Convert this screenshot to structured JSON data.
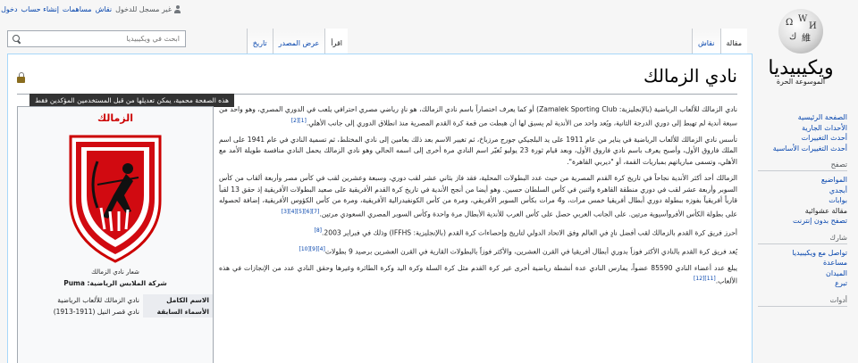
{
  "personal": {
    "not_logged_in": "غير مسجل للدخول",
    "talk": "نقاش",
    "contributions": "مساهمات",
    "create_account": "إنشاء حساب",
    "login": "دخول"
  },
  "logo": {
    "wordmark": "ويكيبيديا",
    "tagline": "الموسوعة الحرة"
  },
  "sidebar": {
    "main_links": [
      "الصفحة الرئيسية",
      "الأحداث الجارية",
      "أحدث التغييرات",
      "أحدث التغييرات الأساسية"
    ],
    "browse_heading": "تصفح",
    "browse_links": [
      "المواضيع",
      "أبجدي",
      "بوابات",
      "مقالة عشوائية",
      "تصفح بدون إنترنت"
    ],
    "participate_heading": "شارك",
    "participate_links": [
      "تواصل مع ويكيبيديا",
      "مساعدة",
      "الميدان",
      "تبرع"
    ],
    "tools_heading": "أدوات"
  },
  "tabs": {
    "article": "مقالة",
    "talk": "نقاش",
    "read": "اقرأ",
    "view_source": "عرض المصدر",
    "history": "تاريخ"
  },
  "search": {
    "placeholder": "ابحث في ويكيبيديا"
  },
  "page": {
    "title": "نادي الزمالك",
    "lock_tooltip": "هذه الصفحة محمية، يمكن تعديلها من قبل المستخدمين المؤكدين فقط"
  },
  "infobox": {
    "title": "الزمالك",
    "caption": "شعار نادي الزمالك",
    "kit_sponsor": "شركة الملابس الرياضية: Puma",
    "rows": [
      {
        "label": "الاسم الكامل",
        "value": "نادي الزمالك للألعاب الرياضية"
      },
      {
        "label": "الأسماء السابقة",
        "value": "نادي قصر النيل (1911-1913)"
      }
    ]
  },
  "article": {
    "p1": "نادي الزمالك للألعاب الرياضية (بالإنجليزية: Zamalek Sporting Club) أو كما يعرف اختصاراً باسم نادي الزمالك، هو نادٍ رياضي مصري احترافي يلعب في الدوري المصري، وهو واحد من سبعة أندية لم تهبط إلى دوري الدرجة الثانية، ويُعد واحد من الأندية لم يسبق لها أن هبطت من قمة كرة القدم المصرية منذ انطلاق الدوري إلى جانب الأهلي.",
    "p1_refs": "[1][2]",
    "p2": "تأسس نادي الزمالك للألعاب الرياضية في يناير من عام 1911 على يد البلجيكي جورج مرزباخ، ثم تغيير الاسم بعد ذلك بعامين إلى نادي المختلط، ثم تسمية النادي في عام 1941 على اسم الملك فاروق الأول، وأصبح يعرف باسم نادي فاروق الأول، وبعد قيام ثورة 23 يوليو تُغيّر اسم النادي مرة أخرى إلى اسمه الحالي وهو نادي الزمالك يحمل النادي منافسة طويلة الأمد مع الأهلي، وتسمى مبارياتهم بمباريات القمة، أو \"ديربي القاهرة\".",
    "p3": "الزمالك أحد أكثر الأندية نجاحاً في تاريخ كرة القدم المصرية من حيث عدد البطولات المحلية، فقد فاز بثاني عشر لقب دوري، وسبعة وعشرين لقب في كأس مصر وأربعة ألقاب من كأس السوبر وأربعة عشر لقب في دوري منطقة القاهرة واثنين في كأس السلطان حسين. وهو أيضا من أنجح الأندية في تاريخ كرة القدم الأفريقية على صعيد البطولات الأفريقية إذ حقق 13 لقباً قارياً أفريقياً بفوزه ببطولة دوري أبطال أفريقيا خمس مرات، و4 مرات بكأس السوبر الأفريقي، ومرة من كأس الكونفيدرالية الأفريقية، ومرة من كأس الكؤوس الأفريقية، إضافة لحصوله على بطولة الكأس الأفروآسيوية مرتين. على الجانب العربي حصل على كأس العرب للأندية الأبطال مرة واحدة وكأس السوبر المصري السعودي مرتين.",
    "p3_refs": "[7][6][5][4][3]",
    "p4": "أحرز فريق كرة القدم بالزمالك لقب أفضل نادٍ في العالم وفق الاتحاد الدولي لتاريخ وإحصاءات كرة القدم (بالإنجليزية: IFFHS) وذلك في فبراير 2003.",
    "p4_refs": "[8]",
    "p5": "يُعد فريق كرة القدم بالنادي الأكثر فوزاً بدوري أبطال أفريقيا في القرن العشرين، والأكثر فوزاً بالبطولات القارية في القرن العشرين برصيد 9 بطولات",
    "p5_refs": "[4][9][10]",
    "p6": "يبلغ عدد أعضاء النادي 85590 عضواً، يمارس النادي عدة أنشطة رياضية أخرى غير كرة القدم مثل كرة السلة وكرة اليد وكرة الطائرة وغيرها وحقق النادي عدد من الإنجازات في هذه الألعاب.",
    "p6_refs": "[11][12]"
  }
}
